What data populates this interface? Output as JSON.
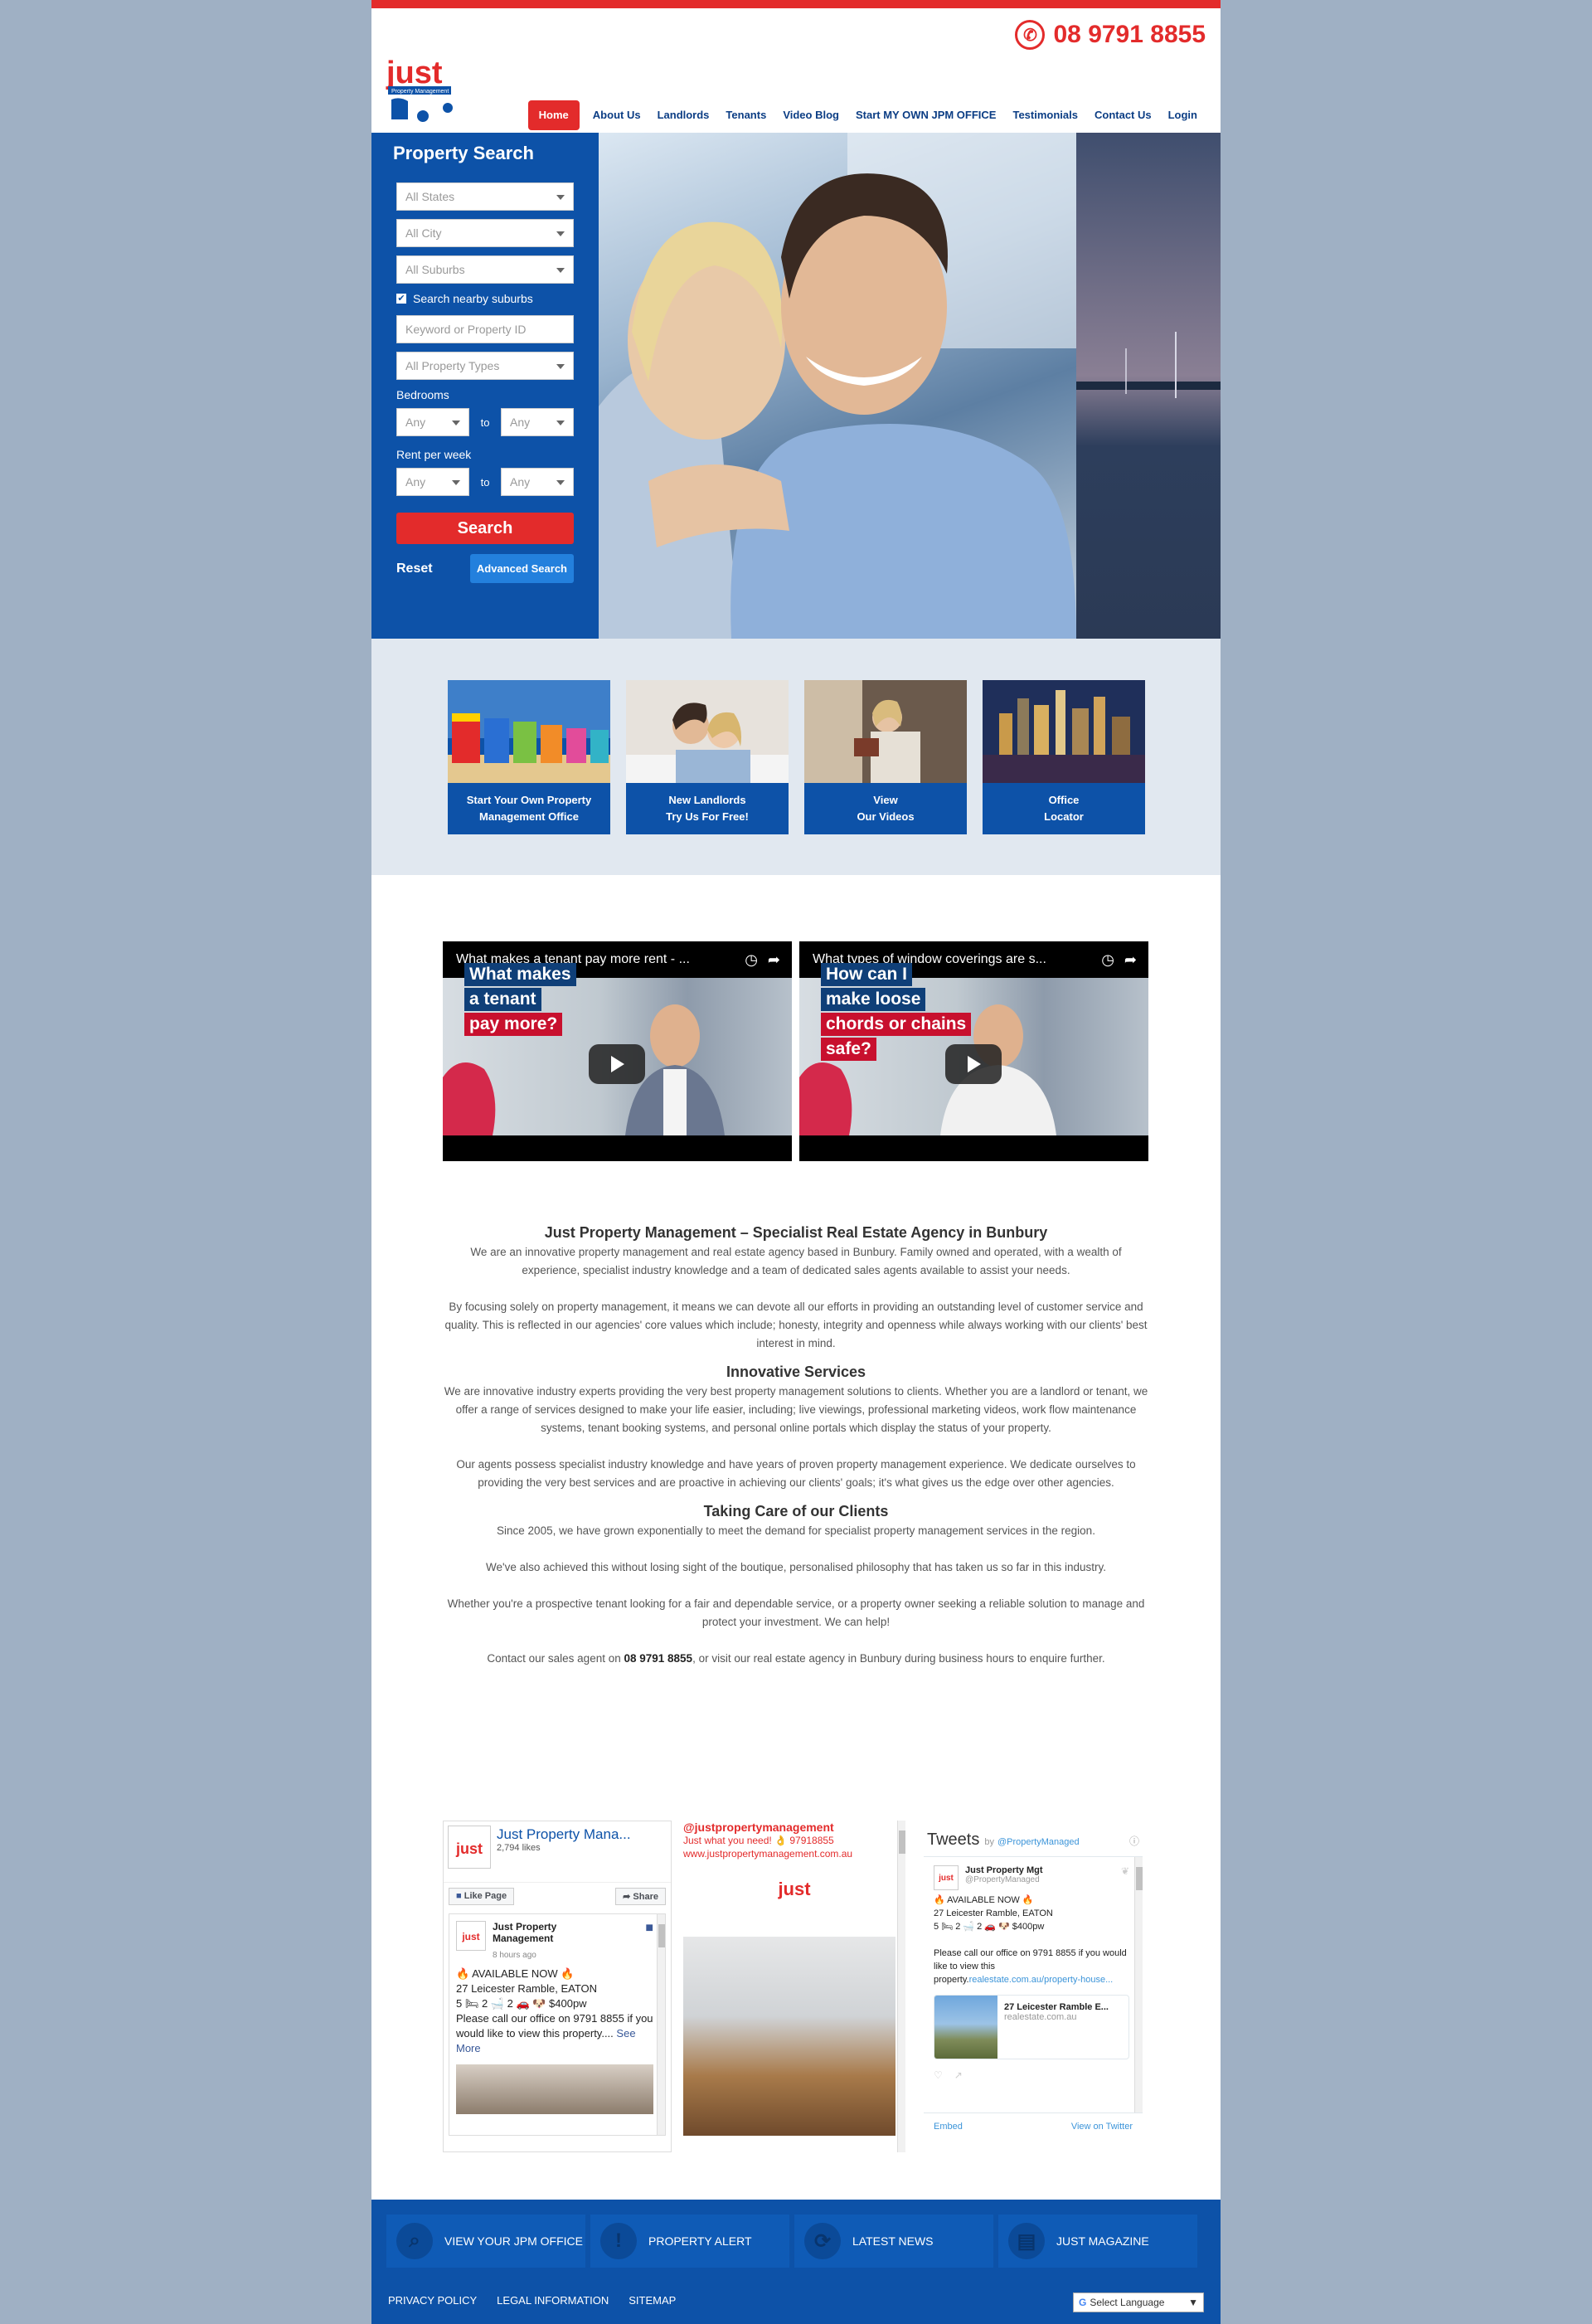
{
  "header": {
    "phone": "08 9791 8855",
    "logo": {
      "word": "just",
      "tagline": "Property Management"
    },
    "nav": [
      "Home",
      "About Us",
      "Landlords",
      "Tenants",
      "Video Blog",
      "Start MY OWN JPM OFFICE",
      "Testimonials",
      "Contact Us",
      "Login"
    ]
  },
  "search": {
    "title": "Property Search",
    "states": "All States",
    "city": "All City",
    "suburbs": "All Suburbs",
    "nearby": "Search nearby suburbs",
    "keyword_placeholder": "Keyword or Property ID",
    "types": "All Property Types",
    "bedrooms_label": "Bedrooms",
    "rent_label": "Rent per week",
    "any": "Any",
    "to": "to",
    "search_button": "Search",
    "reset": "Reset",
    "advanced": "Advanced Search"
  },
  "tiles": [
    {
      "line1": "Start Your Own Property",
      "line2": "Management Office"
    },
    {
      "line1": "New Landlords",
      "line2": "Try Us For Free!"
    },
    {
      "line1": "View",
      "line2": "Our Videos"
    },
    {
      "line1": "Office",
      "line2": "Locator"
    }
  ],
  "videos": [
    {
      "title": "What makes a tenant pay more rent - ...",
      "overlay": [
        "What makes",
        "a tenant",
        "pay more?"
      ]
    },
    {
      "title": "What types of window coverings are s...",
      "overlay": [
        "How can I",
        "make loose",
        "chords or chains",
        "safe?"
      ]
    }
  ],
  "content": {
    "h1": "Just Property Management – Specialist Real Estate Agency in Bunbury",
    "p1": "We are an innovative property management and real estate agency based in Bunbury. Family owned and operated, with a wealth of experience, specialist industry knowledge and a team of dedicated sales agents available to assist your needs.",
    "p2": "By focusing solely on property management, it means we can devote all our efforts in providing an outstanding level of customer service and quality. This is reflected in our agencies' core values which include; honesty, integrity and openness while always working with our clients' best interest in mind.",
    "h2": "Innovative Services",
    "p3": "We are innovative industry experts providing the very best property management solutions to clients. Whether you are a landlord or tenant, we offer a range of services designed to make your life easier, including; live viewings, professional marketing videos, work flow maintenance systems, tenant booking systems, and personal online portals which display the status of your property.",
    "p4": "Our agents possess specialist industry knowledge and have years of proven property management experience. We dedicate ourselves to providing the very best services and are proactive in achieving our clients' goals; it's what gives us the edge over other agencies.",
    "h3": "Taking Care of our Clients",
    "p5": "Since 2005, we have grown exponentially to meet the demand for specialist property management services in the region.",
    "p6": "We've also achieved this without losing sight of the boutique, personalised philosophy that has taken us so far in this industry.",
    "p7": "Whether you're a prospective tenant looking for a fair and dependable service, or a property owner seeking a reliable solution to manage and protect your investment. We can help!",
    "p8_pre": "Contact our sales agent on ",
    "p8_phone": "08 9791 8855",
    "p8_post": ", or visit our real estate agency in Bunbury during business hours to enquire further."
  },
  "facebook": {
    "page_name": "Just Property Mana...",
    "likes": "2,794 likes",
    "like_page": "Like Page",
    "share": "Share",
    "post_author": "Just Property Management",
    "post_time": "8 hours ago",
    "post_line1": "🔥 AVAILABLE NOW 🔥",
    "post_line2": "27 Leicester Ramble, EATON",
    "post_line3": "5 🛏 2 🛁 2 🚗 🐶 $400pw",
    "post_line4": "Please call our office on 9791 8855 if you would like to view this property....",
    "see_more": "See More"
  },
  "instagram": {
    "handle": "@justpropertymanagement",
    "line1": "Just what you need! 👌 97918855",
    "line2": "www.justpropertymanagement.com.au"
  },
  "twitter": {
    "title": "Tweets",
    "by": "by",
    "handle": "@PropertyManaged",
    "author": "Just Property Mgt",
    "author_handle": "@PropertyManaged",
    "l1": "🔥 AVAILABLE NOW 🔥",
    "l2": "27 Leicester Ramble, EATON",
    "l3": "5 🛏 2 🛁 2 🚗 🐶 $400pw",
    "l4": "Please call our office on 9791 8855 if you would like to view this property.",
    "link": "realestate.com.au/property-house...",
    "card_title": "27 Leicester Ramble E...",
    "card_domain": "realestate.com.au",
    "embed": "Embed",
    "view": "View on Twitter"
  },
  "footer": {
    "boxes": [
      "VIEW YOUR JPM OFFICE",
      "PROPERTY ALERT",
      "LATEST NEWS",
      "JUST MAGAZINE"
    ],
    "links": [
      "PRIVACY POLICY",
      "LEGAL INFORMATION",
      "SITEMAP"
    ],
    "language": "Select Language"
  }
}
